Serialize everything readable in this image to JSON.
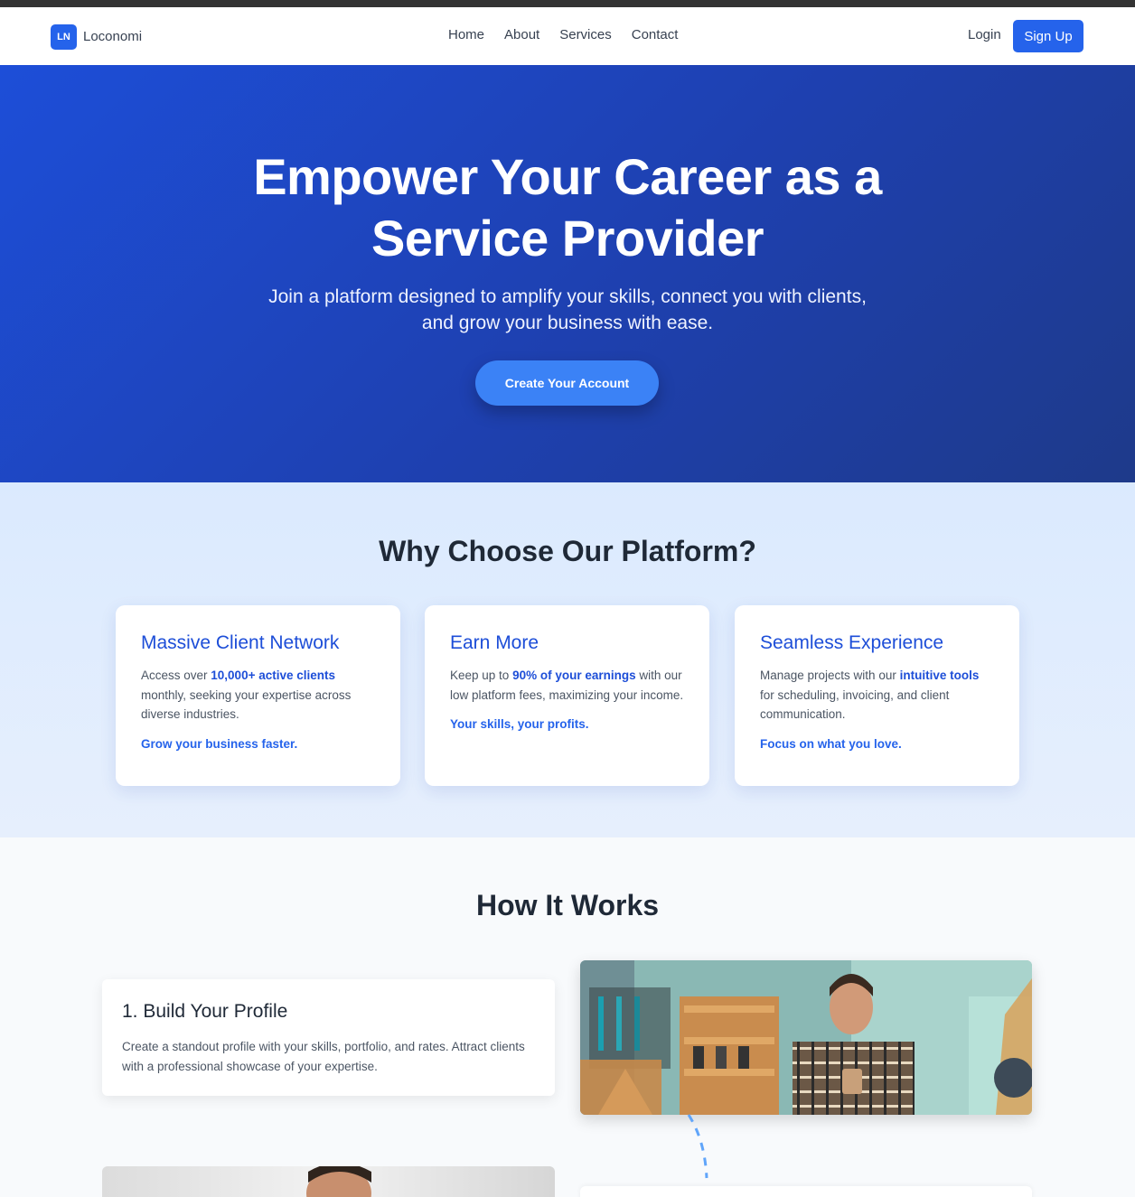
{
  "brand": {
    "logo_text": "LN",
    "name": "Loconomi"
  },
  "nav": {
    "links": [
      "Home",
      "About",
      "Services",
      "Contact"
    ],
    "login": "Login",
    "signup": "Sign Up"
  },
  "hero": {
    "title_line1": "Empower Your Career as a",
    "title_line2": "Service Provider",
    "subtitle": "Join a platform designed to amplify your skills, connect you with clients, and grow your business with ease.",
    "cta": "Create Your Account"
  },
  "why": {
    "title": "Why Choose Our Platform?",
    "cards": [
      {
        "title": "Massive Client Network",
        "pre": "Access over ",
        "bold": "10,000+ active clients",
        "post": " monthly, seeking your expertise across diverse industries.",
        "tag": "Grow your business faster."
      },
      {
        "title": "Earn More",
        "pre": "Keep up to ",
        "bold": "90% of your earnings",
        "post": " with our low platform fees, maximizing your income.",
        "tag": "Your skills, your profits."
      },
      {
        "title": "Seamless Experience",
        "pre": "Manage projects with our ",
        "bold": "intuitive tools",
        "post": " for scheduling, invoicing, and client communication.",
        "tag": "Focus on what you love."
      }
    ]
  },
  "how": {
    "title": "How It Works",
    "steps": [
      {
        "title": "1. Build Your Profile",
        "text": "Create a standout profile with your skills, portfolio, and rates. Attract clients with a professional showcase of your expertise."
      }
    ]
  },
  "colors": {
    "primary": "#2563eb",
    "hero_start": "#1d4ed8",
    "hero_end": "#1e3a8a",
    "accent_text": "#1d4ed8"
  }
}
